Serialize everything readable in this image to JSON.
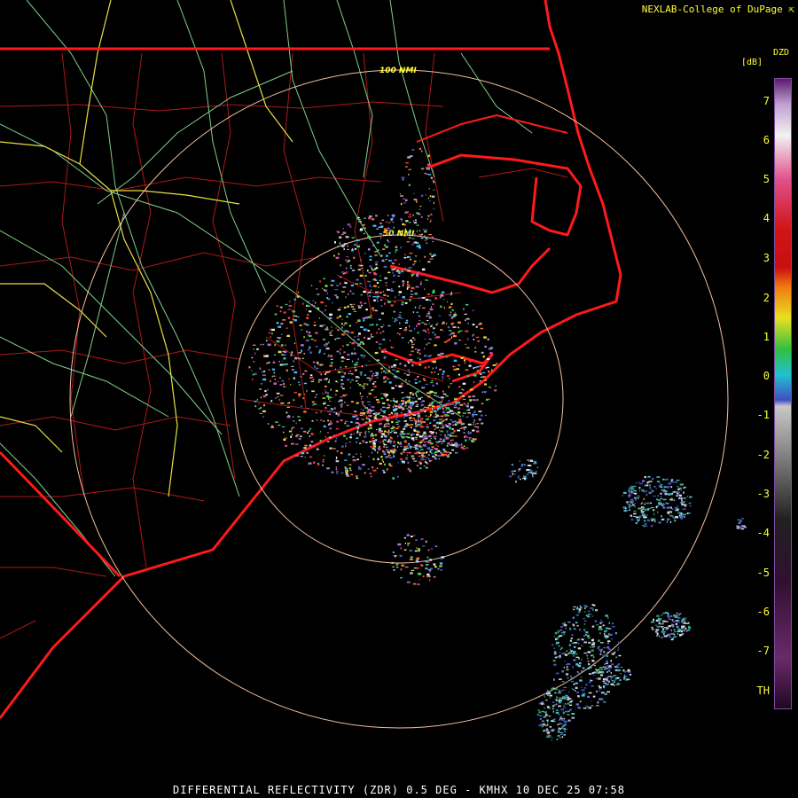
{
  "credit": "NEXLAB-College of DuPage",
  "credit_icon": "cursor-arrow-icon",
  "legend": {
    "product_code": "DZD",
    "unit": "[dB]",
    "ticks": [
      "7",
      "6",
      "5",
      "4",
      "3",
      "2",
      "1",
      "0",
      "-1",
      "-2",
      "-3",
      "-4",
      "-5",
      "-6",
      "-7",
      "TH"
    ],
    "colors": {
      "top": "#5a1a6e",
      "pink_high": "#f2f2f2",
      "pink": "#e0508a",
      "red": "#d01414",
      "orange": "#f07a10",
      "yellow": "#e8e020",
      "green": "#30c040",
      "cyan": "#20c0d0",
      "blue": "#4050c0",
      "gray": "#c8c8c8",
      "dark": "#202020",
      "purple_low": "#6a2a6a"
    }
  },
  "range_rings": [
    "50 NMI",
    "100 NMI"
  ],
  "footer": "DIFFERENTIAL REFLECTIVITY (ZDR) 0.5 DEG - KMHX 10 DEC 25 07:58",
  "map_colors": {
    "coast_state": "#ff1a1a",
    "county": "#c02020",
    "highway_green": "#7fd08a",
    "highway_yellow": "#e8e040",
    "ring": "#f0c0a0"
  }
}
